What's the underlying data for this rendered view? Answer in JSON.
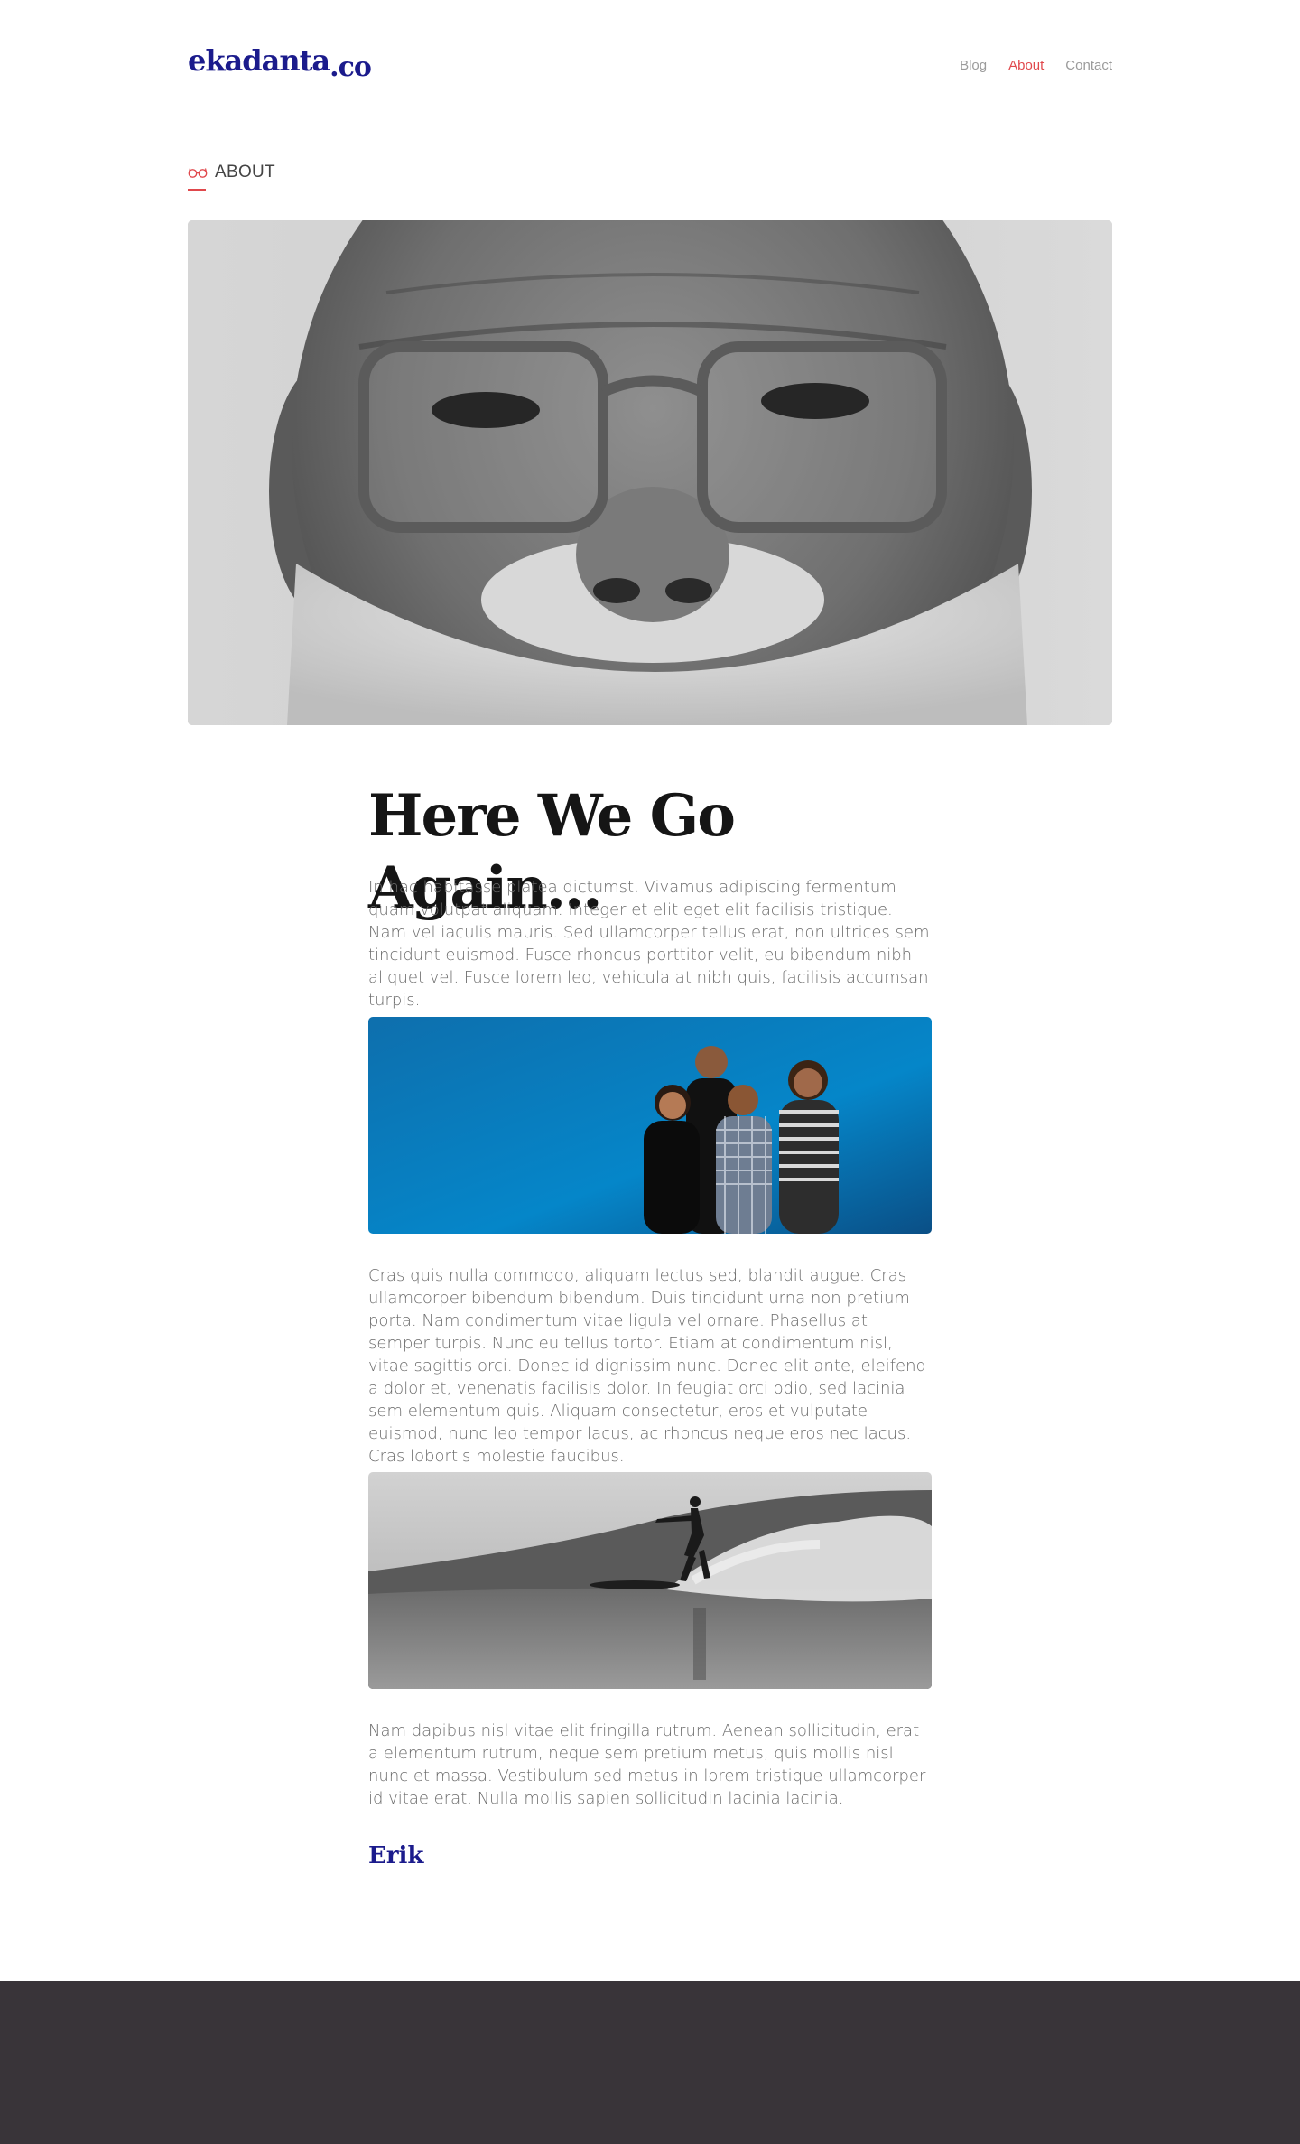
{
  "header": {
    "logo_main": "ekadanta",
    "logo_tld": ".co",
    "nav": [
      {
        "label": "Blog"
      },
      {
        "label": "About"
      },
      {
        "label": "Contact"
      }
    ],
    "active_nav": "About"
  },
  "section": {
    "label": "ABOUT",
    "icon": "glasses-icon"
  },
  "article": {
    "title": "Here We Go Again...",
    "paragraph_1": "In hac habitasse platea dictumst. Vivamus adipiscing fermentum quam volutpat aliquam. Integer et elit eget elit facilisis tristique. Nam vel iaculis mauris. Sed ullamcorper tellus erat, non ultrices sem tincidunt euismod. Fusce rhoncus porttitor velit, eu bibendum nibh aliquet vel. Fusce lorem leo, vehicula at nibh quis, facilisis accumsan turpis.",
    "paragraph_2": "Cras quis nulla commodo, aliquam lectus sed, blandit augue. Cras ullamcorper bibendum bibendum. Duis tincidunt urna non pretium porta. Nam condimentum vitae ligula vel ornare. Phasellus at semper turpis. Nunc eu tellus tortor. Etiam at condimentum nisl, vitae sagittis orci. Donec id dignissim nunc. Donec elit ante, eleifend a dolor et, venenatis facilisis dolor. In feugiat orci odio, sed lacinia sem elementum quis. Aliquam consectetur, eros et vulputate euismod, nunc leo tempor lacus, ac rhoncus neque eros nec lacus. Cras lobortis molestie faucibus.",
    "paragraph_3": "Nam dapibus nisl vitae elit fringilla rutrum. Aenean sollicitudin, erat a elementum rutrum, neque sem pretium metus, quis mollis nisl nunc et massa. Vestibulum sed metus in lorem tristique ullamcorper id vitae erat. Nulla mollis sapien sollicitudin lacinia lacinia.",
    "signature": "Erik"
  },
  "colors": {
    "brand": "#1b1b8c",
    "accent": "#e0484c",
    "footer": "#393439"
  }
}
